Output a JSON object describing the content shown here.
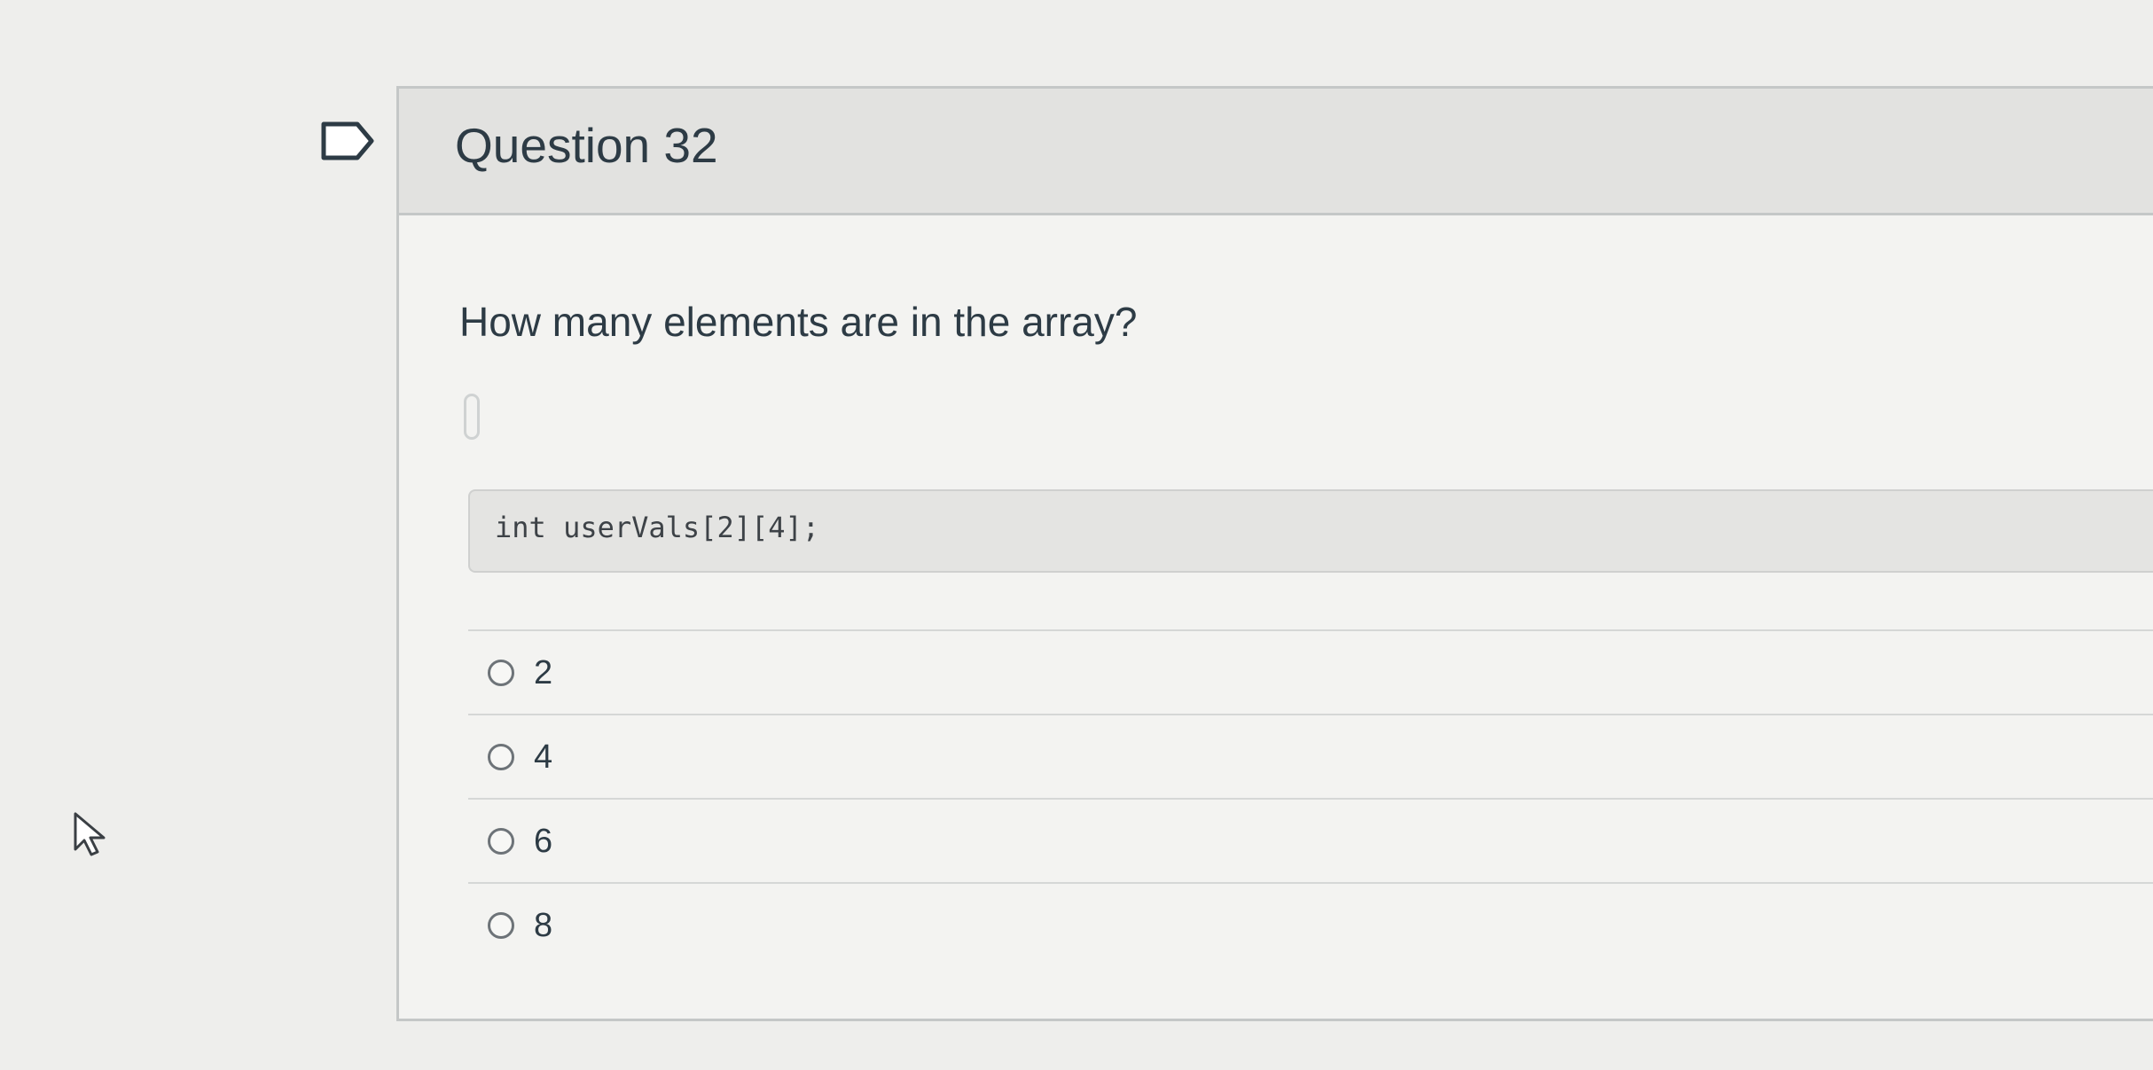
{
  "question": {
    "title": "Question 32",
    "prompt": "How many elements are in the array?",
    "code": "int userVals[2][4];"
  },
  "answers": [
    {
      "label": "2"
    },
    {
      "label": "4"
    },
    {
      "label": "6"
    },
    {
      "label": "8"
    }
  ],
  "icons": {
    "bookmark": "bookmark-flag-icon",
    "pointer": "mouse-pointer-icon"
  },
  "colors": {
    "page_background": "#eeeeec",
    "header_background": "#e2e2e0",
    "text": "#2d3b45",
    "border": "#c4c7c7"
  }
}
